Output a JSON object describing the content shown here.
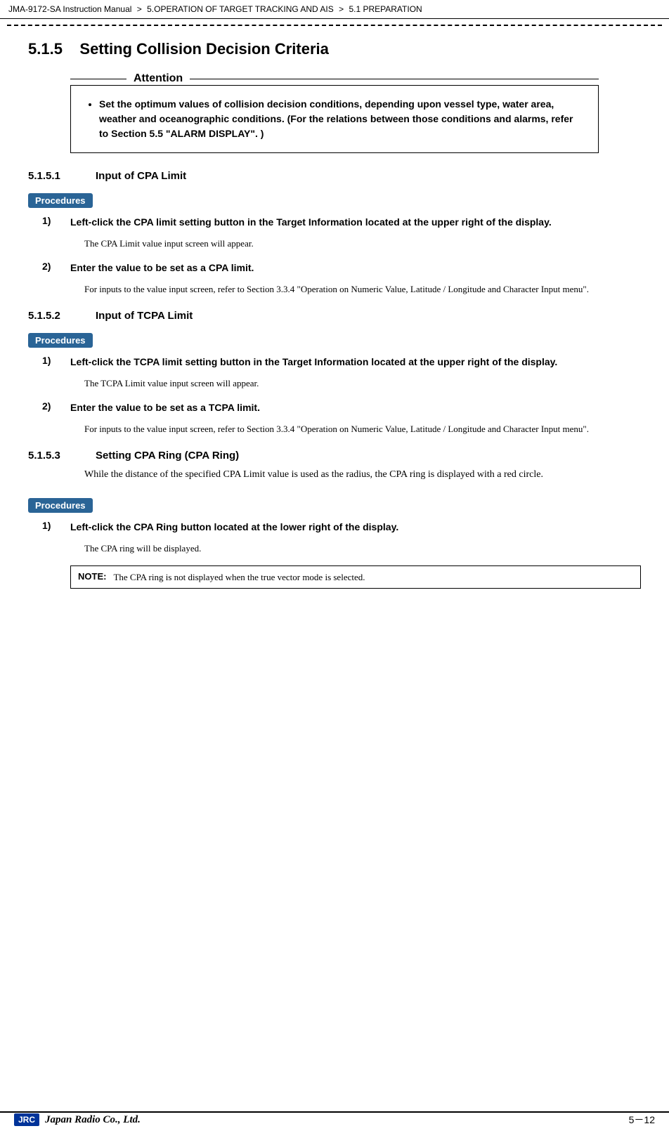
{
  "breadcrumb": {
    "parts": [
      "JMA-9172-SA Instruction Manual",
      ">",
      "5.OPERATION OF TARGET TRACKING AND AIS",
      ">",
      "5.1  PREPARATION"
    ]
  },
  "section": {
    "number": "5.1.5",
    "title": "Setting Collision Decision Criteria"
  },
  "attention": {
    "label": "Attention",
    "items": [
      "Set the optimum values of collision decision conditions, depending upon vessel type, water area, weather and oceanographic conditions. (For the relations between those conditions and alarms, refer to Section 5.5 \"ALARM DISPLAY\". )"
    ]
  },
  "subsections": [
    {
      "number": "5.1.5.1",
      "title": "Input of CPA Limit",
      "procedures_label": "Procedures",
      "steps": [
        {
          "num": "1)",
          "text": "Left-click the CPA limit setting button in the Target Information located at the upper right of the display.",
          "description": "The CPA Limit value input screen will appear."
        },
        {
          "num": "2)",
          "text": "Enter the value to be set as a CPA limit.",
          "description": "For inputs to the value input screen, refer to Section 3.3.4 \"Operation on Numeric Value, Latitude / Longitude and Character Input menu\"."
        }
      ]
    },
    {
      "number": "5.1.5.2",
      "title": "Input of TCPA Limit",
      "procedures_label": "Procedures",
      "steps": [
        {
          "num": "1)",
          "text": "Left-click the TCPA limit setting button in the Target Information located at the upper right of the display.",
          "description": "The TCPA Limit value input screen will appear."
        },
        {
          "num": "2)",
          "text": "Enter the value to be set as a TCPA limit.",
          "description": "For inputs to the value input screen, refer to Section 3.3.4 \"Operation on Numeric Value, Latitude / Longitude and Character Input menu\"."
        }
      ]
    },
    {
      "number": "5.1.5.3",
      "title": "Setting CPA Ring (CPA Ring)",
      "intro": "While the distance of the specified CPA Limit value is used as the radius, the CPA ring is displayed with a red circle.",
      "procedures_label": "Procedures",
      "steps": [
        {
          "num": "1)",
          "text": "Left-click the  CPA Ring  button located at the lower right of the display.",
          "description": "The CPA ring will be displayed."
        }
      ],
      "note": {
        "label": "NOTE:",
        "text": "The CPA ring is not displayed when the true vector mode is selected."
      }
    }
  ],
  "footer": {
    "jrc_label": "JRC",
    "company": "Japan Radio Co., Ltd.",
    "page": "5－12"
  }
}
